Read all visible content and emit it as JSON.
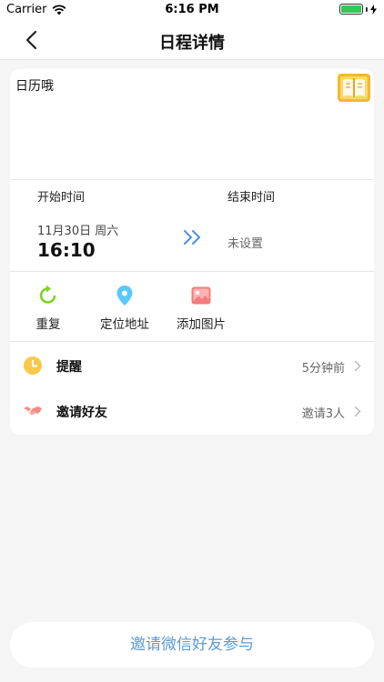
{
  "status_bar": {
    "carrier": "Carrier",
    "time": "6:16 PM"
  },
  "nav": {
    "title": "日程详情",
    "back_icon": "chevron-left-icon"
  },
  "event": {
    "title": "日历哦",
    "badge_icon": "book-icon"
  },
  "schedule": {
    "start_label": "开始时间",
    "end_label": "结束时间",
    "start_date": "11月30日 周六",
    "start_time": "16:10",
    "end_value": "未设置"
  },
  "actions": [
    {
      "label": "重复",
      "icon": "repeat-icon",
      "color": "#7ed321"
    },
    {
      "label": "定位地址",
      "icon": "location-pin-icon",
      "color": "#5ac8fa"
    },
    {
      "label": "添加图片",
      "icon": "image-icon",
      "color": "#f47c7c"
    }
  ],
  "rows": [
    {
      "label": "提醒",
      "value": "5分钟前",
      "icon": "clock-icon",
      "color": "#f8c94b"
    },
    {
      "label": "邀请好友",
      "value": "邀请3人",
      "icon": "handshake-icon",
      "color": "#f28b82"
    }
  ],
  "footer": {
    "invite_label": "邀请微信好友参与",
    "accent": "#5b9bd5"
  }
}
